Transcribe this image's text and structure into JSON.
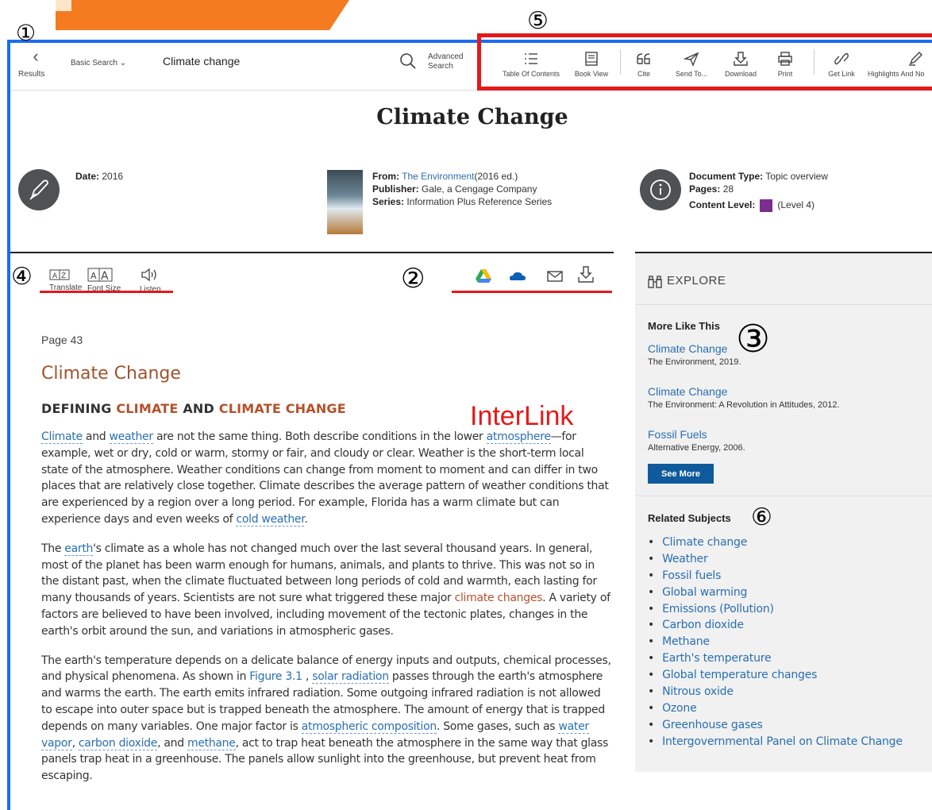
{
  "annotations": {
    "n1": "①",
    "n2": "②",
    "n3": "③",
    "n4": "④",
    "n5": "⑤",
    "n6": "⑥",
    "interlink": "InterLink"
  },
  "toolbar": {
    "results_label": "Results",
    "search_type": "Basic Search ⌄",
    "search_value": "Climate change",
    "advanced_search_line1": "Advanced",
    "advanced_search_line2": "Search",
    "tools": [
      {
        "label": "Table Of Contents",
        "icon": "list-icon"
      },
      {
        "label": "Book View",
        "icon": "book-icon"
      },
      {
        "label": "Cite",
        "icon": "quote-icon"
      },
      {
        "label": "Send To...",
        "icon": "send-icon"
      },
      {
        "label": "Download",
        "icon": "download-icon"
      },
      {
        "label": "Print",
        "icon": "print-icon"
      },
      {
        "label": "Get Link",
        "icon": "link-icon"
      },
      {
        "label": "Highlights And No",
        "icon": "highlight-icon"
      }
    ]
  },
  "document": {
    "title": "Climate Change",
    "date_label": "Date:",
    "date_value": "2016",
    "from_label": "From:",
    "from_link": "The Environment",
    "from_edition": "(2016 ed.)",
    "publisher_label": "Publisher:",
    "publisher_value": "Gale, a Cengage Company",
    "series_label": "Series:",
    "series_value": "Information Plus Reference Series",
    "doctype_label": "Document Type:",
    "doctype_value": "Topic overview",
    "pages_label": "Pages:",
    "pages_value": "28",
    "level_label": "Content Level:",
    "level_value": "(Level 4)"
  },
  "content_tools": {
    "translate": "Translate",
    "font_size": "Font Size",
    "listen": "Listen"
  },
  "article": {
    "page": "Page 43",
    "title": "Climate Change",
    "section_pre": "DEFINING ",
    "section_kw1": "CLIMATE",
    "section_mid": " AND ",
    "section_kw2": "CLIMATE CHANGE",
    "p1": [
      {
        "t": "Climate",
        "link": true
      },
      {
        "t": " and "
      },
      {
        "t": "weather",
        "link": true
      },
      {
        "t": " are not the same thing. Both describe conditions in the lower "
      },
      {
        "t": "atmosphere",
        "link": true
      },
      {
        "t": "—for example, wet or dry, cold or warm, stormy or fair, and cloudy or clear. Weather is the short-term local state of the atmosphere. Weather conditions can change from moment to moment and can differ in two places that are relatively close together. Climate describes the average pattern of weather conditions that are experienced by a region over a long period. For example, Florida has a warm climate but can experience days and even weeks of "
      },
      {
        "t": "cold weather",
        "link": true
      },
      {
        "t": "."
      }
    ],
    "p2": [
      {
        "t": "The "
      },
      {
        "t": "earth",
        "link": true
      },
      {
        "t": "'s climate as a whole has not changed much over the last several thousand years. In general, most of the planet has been warm enough for humans, animals, and plants to thrive. This was not so in the distant past, when the climate fluctuated between long periods of cold and warmth, each lasting for many thousands of years. Scientists are not sure what triggered these major "
      },
      {
        "t": "climate changes",
        "link": true,
        "rust": true
      },
      {
        "t": ". A variety of factors are believed to have been involved, including movement of the tectonic plates, changes in the earth's orbit around the sun, and variations in atmospheric gases."
      }
    ],
    "p3": [
      {
        "t": "The earth's temperature depends on a delicate balance of energy inputs and outputs, chemical processes, and physical phenomena. As shown in "
      },
      {
        "t": "Figure 3.1",
        "link": true,
        "fig": true
      },
      {
        "t": " , "
      },
      {
        "t": "solar radiation",
        "link": true
      },
      {
        "t": " passes through the earth's atmosphere and warms the earth. The earth emits infrared radiation. Some outgoing infrared radiation is not allowed to escape into outer space but is trapped beneath the atmosphere. The amount of energy that is trapped depends on many variables. One major factor is "
      },
      {
        "t": "atmospheric composition",
        "link": true
      },
      {
        "t": ". Some gases, such as "
      },
      {
        "t": "water vapor",
        "link": true
      },
      {
        "t": ", "
      },
      {
        "t": "carbon dioxide",
        "link": true
      },
      {
        "t": ", and "
      },
      {
        "t": "methane",
        "link": true
      },
      {
        "t": ", act to trap heat beneath the atmosphere in the same way that glass panels trap heat in a greenhouse. The panels allow sunlight into the greenhouse, but prevent heat from escaping."
      }
    ]
  },
  "sidebar": {
    "explore": "EXPLORE",
    "more_like_this": "More Like This",
    "more_items": [
      {
        "title": "Climate Change",
        "source": "The Environment, 2019."
      },
      {
        "title": "Climate Change",
        "source": "The Environment: A Revolution in Attitudes, 2012."
      },
      {
        "title": "Fossil Fuels",
        "source": "Alternative Energy, 2006."
      }
    ],
    "see_more": "See More",
    "related_subjects": "Related Subjects",
    "subjects": [
      "Climate change",
      "Weather",
      "Fossil fuels",
      "Global warming",
      "Emissions (Pollution)",
      "Carbon dioxide",
      "Methane",
      "Earth's temperature",
      "Global temperature changes",
      "Nitrous oxide",
      "Ozone",
      "Greenhouse gases",
      "Intergovernmental Panel on Climate Change"
    ]
  },
  "colors": {
    "frame_blue": "#1a6cf0",
    "annotation_red": "#e3191b",
    "accent_orange": "#f47b20",
    "link_blue": "#2a6fb0",
    "rust": "#b5512b"
  }
}
